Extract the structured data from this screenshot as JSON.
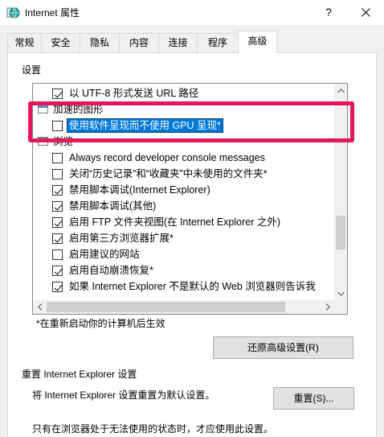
{
  "window": {
    "title": "Internet 属性",
    "help_label": "?"
  },
  "tabs": [
    {
      "label": "常规"
    },
    {
      "label": "安全"
    },
    {
      "label": "隐私"
    },
    {
      "label": "内容"
    },
    {
      "label": "连接"
    },
    {
      "label": "程序"
    },
    {
      "label": "高级",
      "selected": true
    }
  ],
  "settings": {
    "label": "设置",
    "tree": [
      {
        "label": "以 UTF-8 形式发送 URL 路径",
        "checked": true
      },
      {
        "label": "加速的图形",
        "group": true
      },
      {
        "label": "使用软件呈现而不使用 GPU 呈现*",
        "checked": false,
        "selected": true
      },
      {
        "label": "浏览",
        "group": true
      },
      {
        "label": "Always record developer console messages",
        "checked": false
      },
      {
        "label": "关闭“历史记录”和“收藏夹”中未使用的文件夹*",
        "checked": false
      },
      {
        "label": "禁用脚本调试(Internet Explorer)",
        "checked": true
      },
      {
        "label": "禁用脚本调试(其他)",
        "checked": true
      },
      {
        "label": "启用 FTP 文件夹视图(在 Internet Explorer 之外)",
        "checked": true
      },
      {
        "label": "启用第三方浏览器扩展*",
        "checked": true
      },
      {
        "label": "启用建议的网站",
        "checked": false
      },
      {
        "label": "启用自动崩溃恢复*",
        "checked": true
      },
      {
        "label": "如果 Internet Explorer 不是默认的 Web 浏览器则告诉我",
        "checked": true
      }
    ],
    "scroll": {
      "vertical": {
        "position": 0.76,
        "visible_fraction": 0.18
      },
      "horizontal": {
        "position": 0,
        "visible_fraction": 0.87
      }
    },
    "note": "*在重新启动你的计算机后生效",
    "restore_button": "还原高级设置(R)"
  },
  "reset": {
    "title": "重置 Internet Explorer 设置",
    "description": "将 Internet Explorer 设置重置为默认设置。",
    "button": "重置(S)...",
    "warning": "只有在浏览器处于无法使用的状态时，才应使用此设置。"
  },
  "icons": {
    "window": "internet-options-icon",
    "close": "close-icon",
    "group": "settings-group-icon",
    "scroll_up": "chevron-up-icon",
    "scroll_down": "chevron-down-icon",
    "scroll_left": "chevron-left-icon",
    "scroll_right": "chevron-right-icon"
  },
  "colors": {
    "selection": "#0078d7",
    "highlight_annotation": "#e2185b",
    "scroll_thumb": "#cdcdcd"
  }
}
